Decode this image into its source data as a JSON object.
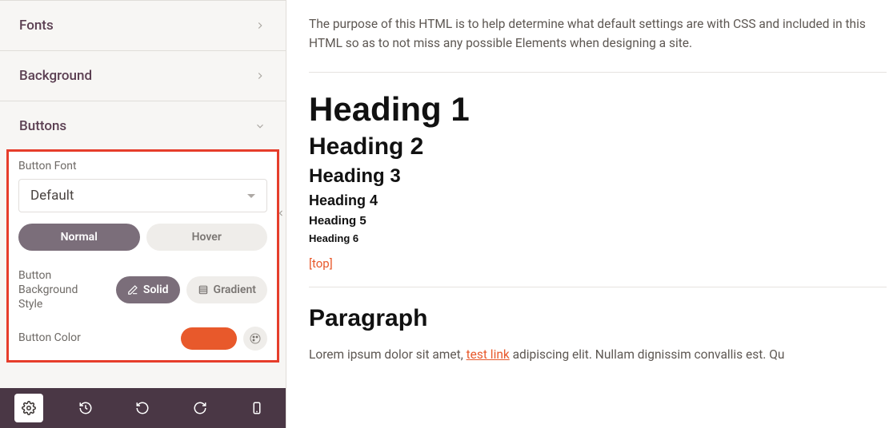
{
  "sidebar": {
    "sections": {
      "fonts": {
        "label": "Fonts"
      },
      "background": {
        "label": "Background"
      },
      "buttons": {
        "label": "Buttons"
      }
    },
    "panel": {
      "button_font_label": "Button Font",
      "button_font_value": "Default",
      "state_tabs": {
        "normal": "Normal",
        "hover": "Hover",
        "active": "normal"
      },
      "bg_style_label": "Button Background Style",
      "bg_style_options": {
        "solid": "Solid",
        "gradient": "Gradient",
        "active": "solid"
      },
      "button_color_label": "Button Color",
      "button_color_value": "#e8592b"
    }
  },
  "preview": {
    "intro": "The purpose of this HTML is to help determine what default settings are with CSS and included in this HTML so as to not miss any possible Elements when designing a site.",
    "h1": "Heading 1",
    "h2": "Heading 2",
    "h3": "Heading 3",
    "h4": "Heading 4",
    "h5": "Heading 5",
    "h6": "Heading 6",
    "top_link": "[top]",
    "paragraph_title": "Paragraph",
    "paragraph_prefix": "Lorem ipsum dolor sit amet, ",
    "test_link": "test link",
    "paragraph_suffix": " adipiscing elit. Nullam dignissim convallis est. Qu"
  }
}
